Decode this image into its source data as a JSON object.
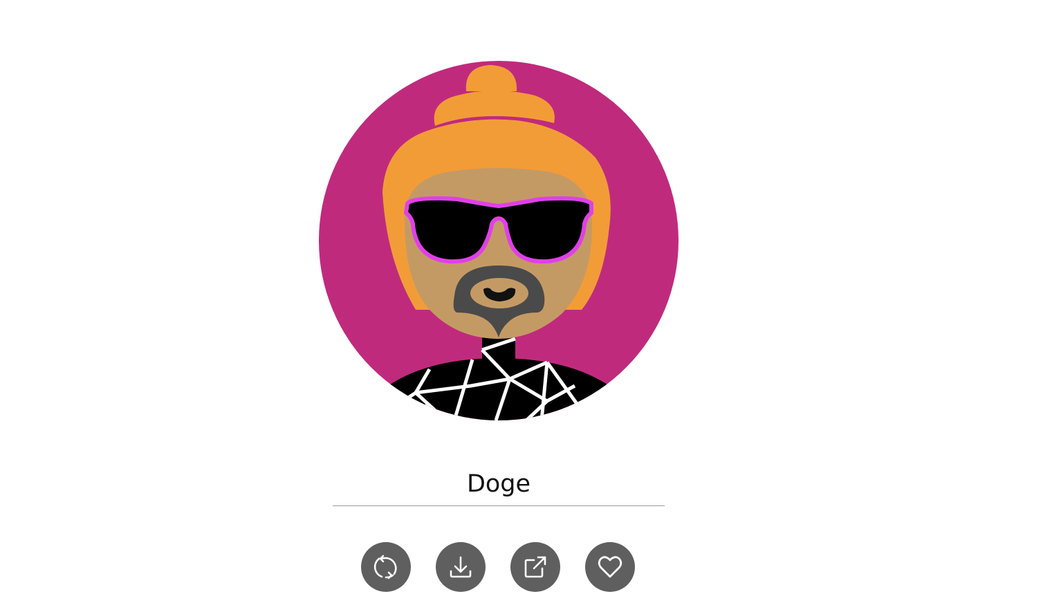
{
  "avatar": {
    "background_color": "#C02A7D",
    "hair_color": "#F29C38",
    "skin_color": "#C49A64",
    "glasses_frame_color": "#E040E8",
    "beard_color": "#4A4A4A",
    "shirt_color": "#000000",
    "shirt_pattern_color": "#FFFFFF"
  },
  "name_field": {
    "value": "Doge"
  },
  "actions": [
    {
      "name": "regenerate",
      "icon": "refresh-icon"
    },
    {
      "name": "download",
      "icon": "download-icon"
    },
    {
      "name": "share",
      "icon": "external-link-icon"
    },
    {
      "name": "favorite",
      "icon": "heart-icon"
    }
  ],
  "colors": {
    "button_bg": "#5F5F5F",
    "icon_color": "#FFFFFF",
    "underline": "#9A9A9A"
  }
}
